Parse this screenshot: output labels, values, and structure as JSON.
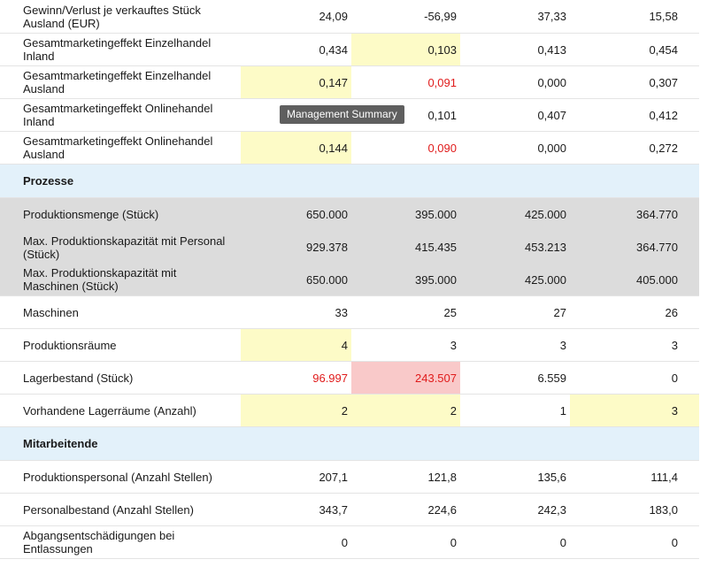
{
  "rows_top": [
    {
      "label": "Gewinn/Verlust je verkauftes Stück Ausland (EUR)",
      "values": [
        "24,09",
        "-56,99",
        "37,33",
        "15,58"
      ]
    },
    {
      "label": "Gesamtmarketingeffekt Einzelhandel Inland",
      "values": [
        "0,434",
        "0,103",
        "0,413",
        "0,454"
      ]
    },
    {
      "label": "Gesamtmarketingeffekt Einzelhandel Ausland",
      "values": [
        "0,147",
        "0,091",
        "0,000",
        "0,307"
      ]
    },
    {
      "label": "Gesamtmarketingeffekt Onlinehandel Inland",
      "values": [
        "",
        "0,101",
        "0,407",
        "0,412"
      ]
    },
    {
      "label": "Gesamtmarketingeffekt Onlinehandel Ausland",
      "values": [
        "0,144",
        "0,090",
        "0,000",
        "0,272"
      ]
    }
  ],
  "section_prozesse": "Prozesse",
  "rows_prozesse": [
    {
      "label": "Produktionsmenge (Stück)",
      "values": [
        "650.000",
        "395.000",
        "425.000",
        "364.770"
      ]
    },
    {
      "label": "Max. Produktionskapazität mit Personal (Stück)",
      "values": [
        "929.378",
        "415.435",
        "453.213",
        "364.770"
      ]
    },
    {
      "label": "Max. Produktionskapazität mit Maschinen (Stück)",
      "values": [
        "650.000",
        "395.000",
        "425.000",
        "405.000"
      ]
    },
    {
      "label": "Maschinen",
      "values": [
        "33",
        "25",
        "27",
        "26"
      ]
    },
    {
      "label": "Produktionsräume",
      "values": [
        "4",
        "3",
        "3",
        "3"
      ]
    },
    {
      "label": "Lagerbestand (Stück)",
      "values": [
        "96.997",
        "243.507",
        "6.559",
        "0"
      ]
    },
    {
      "label": "Vorhandene Lagerräume (Anzahl)",
      "values": [
        "2",
        "2",
        "1",
        "3"
      ]
    }
  ],
  "section_mitarbeitende": "Mitarbeitende",
  "rows_mitarbeitende": [
    {
      "label": "Produktionspersonal (Anzahl Stellen)",
      "values": [
        "207,1",
        "121,8",
        "135,6",
        "111,4"
      ]
    },
    {
      "label": "Personalbestand (Anzahl Stellen)",
      "values": [
        "343,7",
        "224,6",
        "242,3",
        "183,0"
      ]
    },
    {
      "label": "Abgangsentschädigungen bei Entlassungen",
      "values": [
        "0",
        "0",
        "0",
        "0"
      ]
    }
  ],
  "tooltip": "Management Summary",
  "colors": {
    "highlight_yellow": "#fdfbc7",
    "highlight_pink": "#f9c9c9",
    "negative_red": "#e01b1b",
    "section_blue": "#e3f1fa",
    "group_gray": "#dcdcdc"
  }
}
